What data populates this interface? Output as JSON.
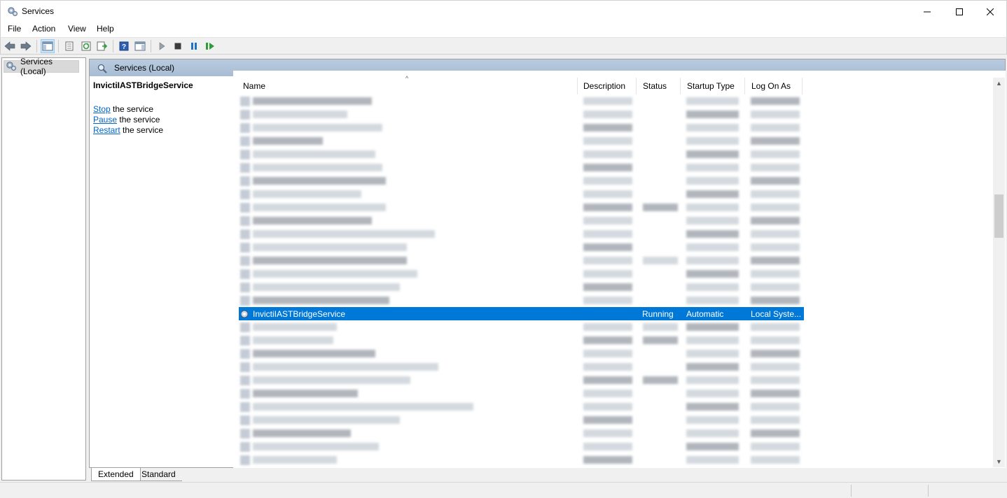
{
  "window": {
    "title": "Services"
  },
  "menu": [
    "File",
    "Action",
    "View",
    "Help"
  ],
  "toolbar": {
    "buttons": [
      "back-icon",
      "forward-icon",
      "show-hide-console-tree-icon",
      "properties-icon",
      "refresh-icon",
      "export-list-icon",
      "help-icon",
      "show-action-pane-icon",
      "start-service-icon",
      "stop-service-icon",
      "pause-service-icon",
      "restart-service-icon"
    ]
  },
  "tree": {
    "root_label": "Services (Local)"
  },
  "pane": {
    "header_label": "Services (Local)",
    "selected_service": "InvictiIASTBridgeService",
    "actions": [
      {
        "link": "Stop",
        "rest": " the service"
      },
      {
        "link": "Pause",
        "rest": " the service"
      },
      {
        "link": "Restart",
        "rest": " the service"
      }
    ]
  },
  "columns": [
    "Name",
    "Description",
    "Status",
    "Startup Type",
    "Log On As"
  ],
  "selected_row": {
    "name": "InvictiIASTBridgeService",
    "description": "",
    "status": "Running",
    "startup_type": "Automatic",
    "log_on_as": "Local Syste..."
  },
  "tabs": [
    "Extended",
    "Standard"
  ],
  "colors": {
    "selection": "#0078d7",
    "link": "#0066cc",
    "header_gradient": "#b0c4dc"
  }
}
